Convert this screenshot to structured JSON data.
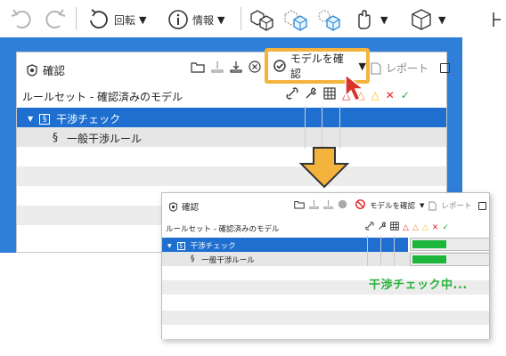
{
  "toolbar": {
    "rotate_label": "回転",
    "info_label": "情報"
  },
  "panel": {
    "title": "確認",
    "check_model_label": "モデルを確認",
    "report_label": "レポート",
    "column_header": "ルールセット - 確認済みのモデル",
    "rows": [
      {
        "icon": "§",
        "label": "干渉チェック"
      },
      {
        "icon": "§",
        "label": "一般干渉ルール"
      }
    ]
  },
  "panel_zoom": {
    "title": "確認",
    "check_model_label": "モデルを確認",
    "report_label": "レポート",
    "column_header": "ルールセット - 確認済みのモデル",
    "rows": [
      {
        "icon": "§",
        "label": "干渉チェック",
        "progress": 0.45
      },
      {
        "icon": "§",
        "label": "一般干渉ルール",
        "progress": 0.45
      }
    ],
    "status_text": "干渉チェック中..."
  },
  "colors": {
    "selection_blue": "#1e6fd0",
    "backdrop_blue": "#2f7ed8",
    "highlight_orange": "#f3b33d",
    "progress_green": "#1db63c",
    "status_green": "#2bb13c"
  }
}
